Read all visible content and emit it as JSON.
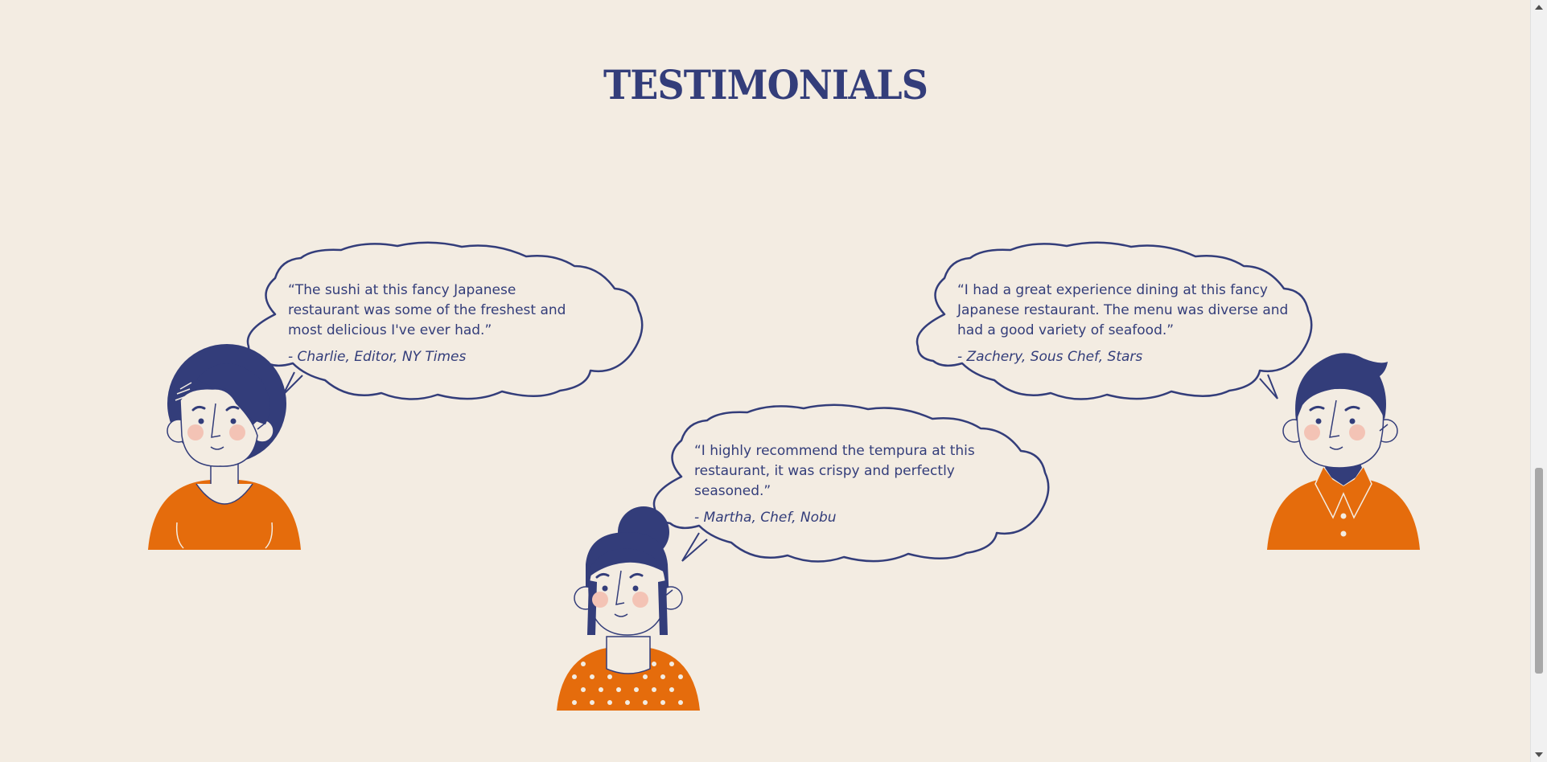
{
  "section": {
    "title": "TESTIMONIALS"
  },
  "testimonials": [
    {
      "quote": "“The sushi at this fancy Japanese restaurant was some of the freshest and most delicious I've ever had.”",
      "author": "- Charlie, Editor, NY Times"
    },
    {
      "quote": "“I highly recommend the tempura at this restaurant, it was crispy and perfectly seasoned.”",
      "author": "- Martha, Chef, Nobu"
    },
    {
      "quote": "“I had a great experience dining at this fancy Japanese restaurant. The menu was diverse and had a good variety of seafood.”",
      "author": "- Zachery, Sous Chef, Stars"
    }
  ],
  "colors": {
    "background": "#f3ece2",
    "navy": "#333d7a",
    "orange": "#e56c0c",
    "blush": "#f3c3b5"
  }
}
